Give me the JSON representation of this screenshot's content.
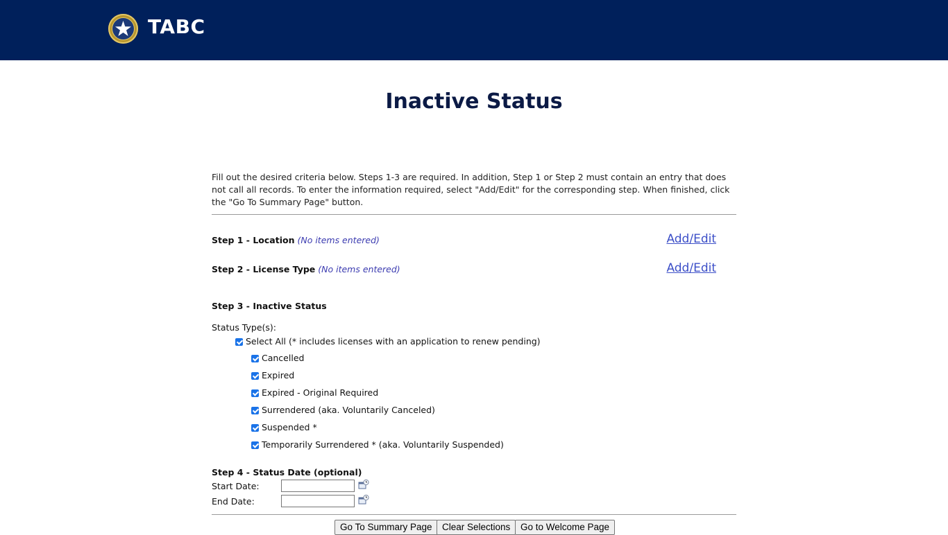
{
  "header": {
    "brand": "TABC"
  },
  "page": {
    "title": "Inactive Status"
  },
  "intro": "Fill out the desired criteria below. Steps 1-3 are required. In addition, Step 1 or Step 2 must contain an entry that does not call all records. To enter the information required, select \"Add/Edit\" for the corresponding step. When finished, click the \"Go To Summary Page\" button.",
  "step1": {
    "label": "Step 1 - Location",
    "status": "(No items entered)",
    "link": "Add/Edit"
  },
  "step2": {
    "label": "Step 2 - License Type",
    "status": "(No items entered)",
    "link": "Add/Edit"
  },
  "step3": {
    "label": "Step 3 - Inactive Status",
    "status_types_label": "Status Type(s):",
    "select_all": "Select All (* includes licenses with an application to renew pending)",
    "options": [
      "Cancelled",
      "Expired",
      "Expired - Original Required",
      "Surrendered (aka. Voluntarily Canceled)",
      "Suspended *",
      "Temporarily Surrendered * (aka. Voluntarily Suspended)"
    ]
  },
  "step4": {
    "label": "Step 4 - Status Date (optional)",
    "start_label": "Start Date:",
    "end_label": "End Date:",
    "start_value": "",
    "end_value": ""
  },
  "buttons": {
    "summary": "Go To Summary Page",
    "clear": "Clear Selections",
    "welcome": "Go to Welcome Page"
  },
  "colors": {
    "header_bg": "#00205b",
    "link": "#3c4fc8",
    "checkbox": "#1a73e8"
  }
}
